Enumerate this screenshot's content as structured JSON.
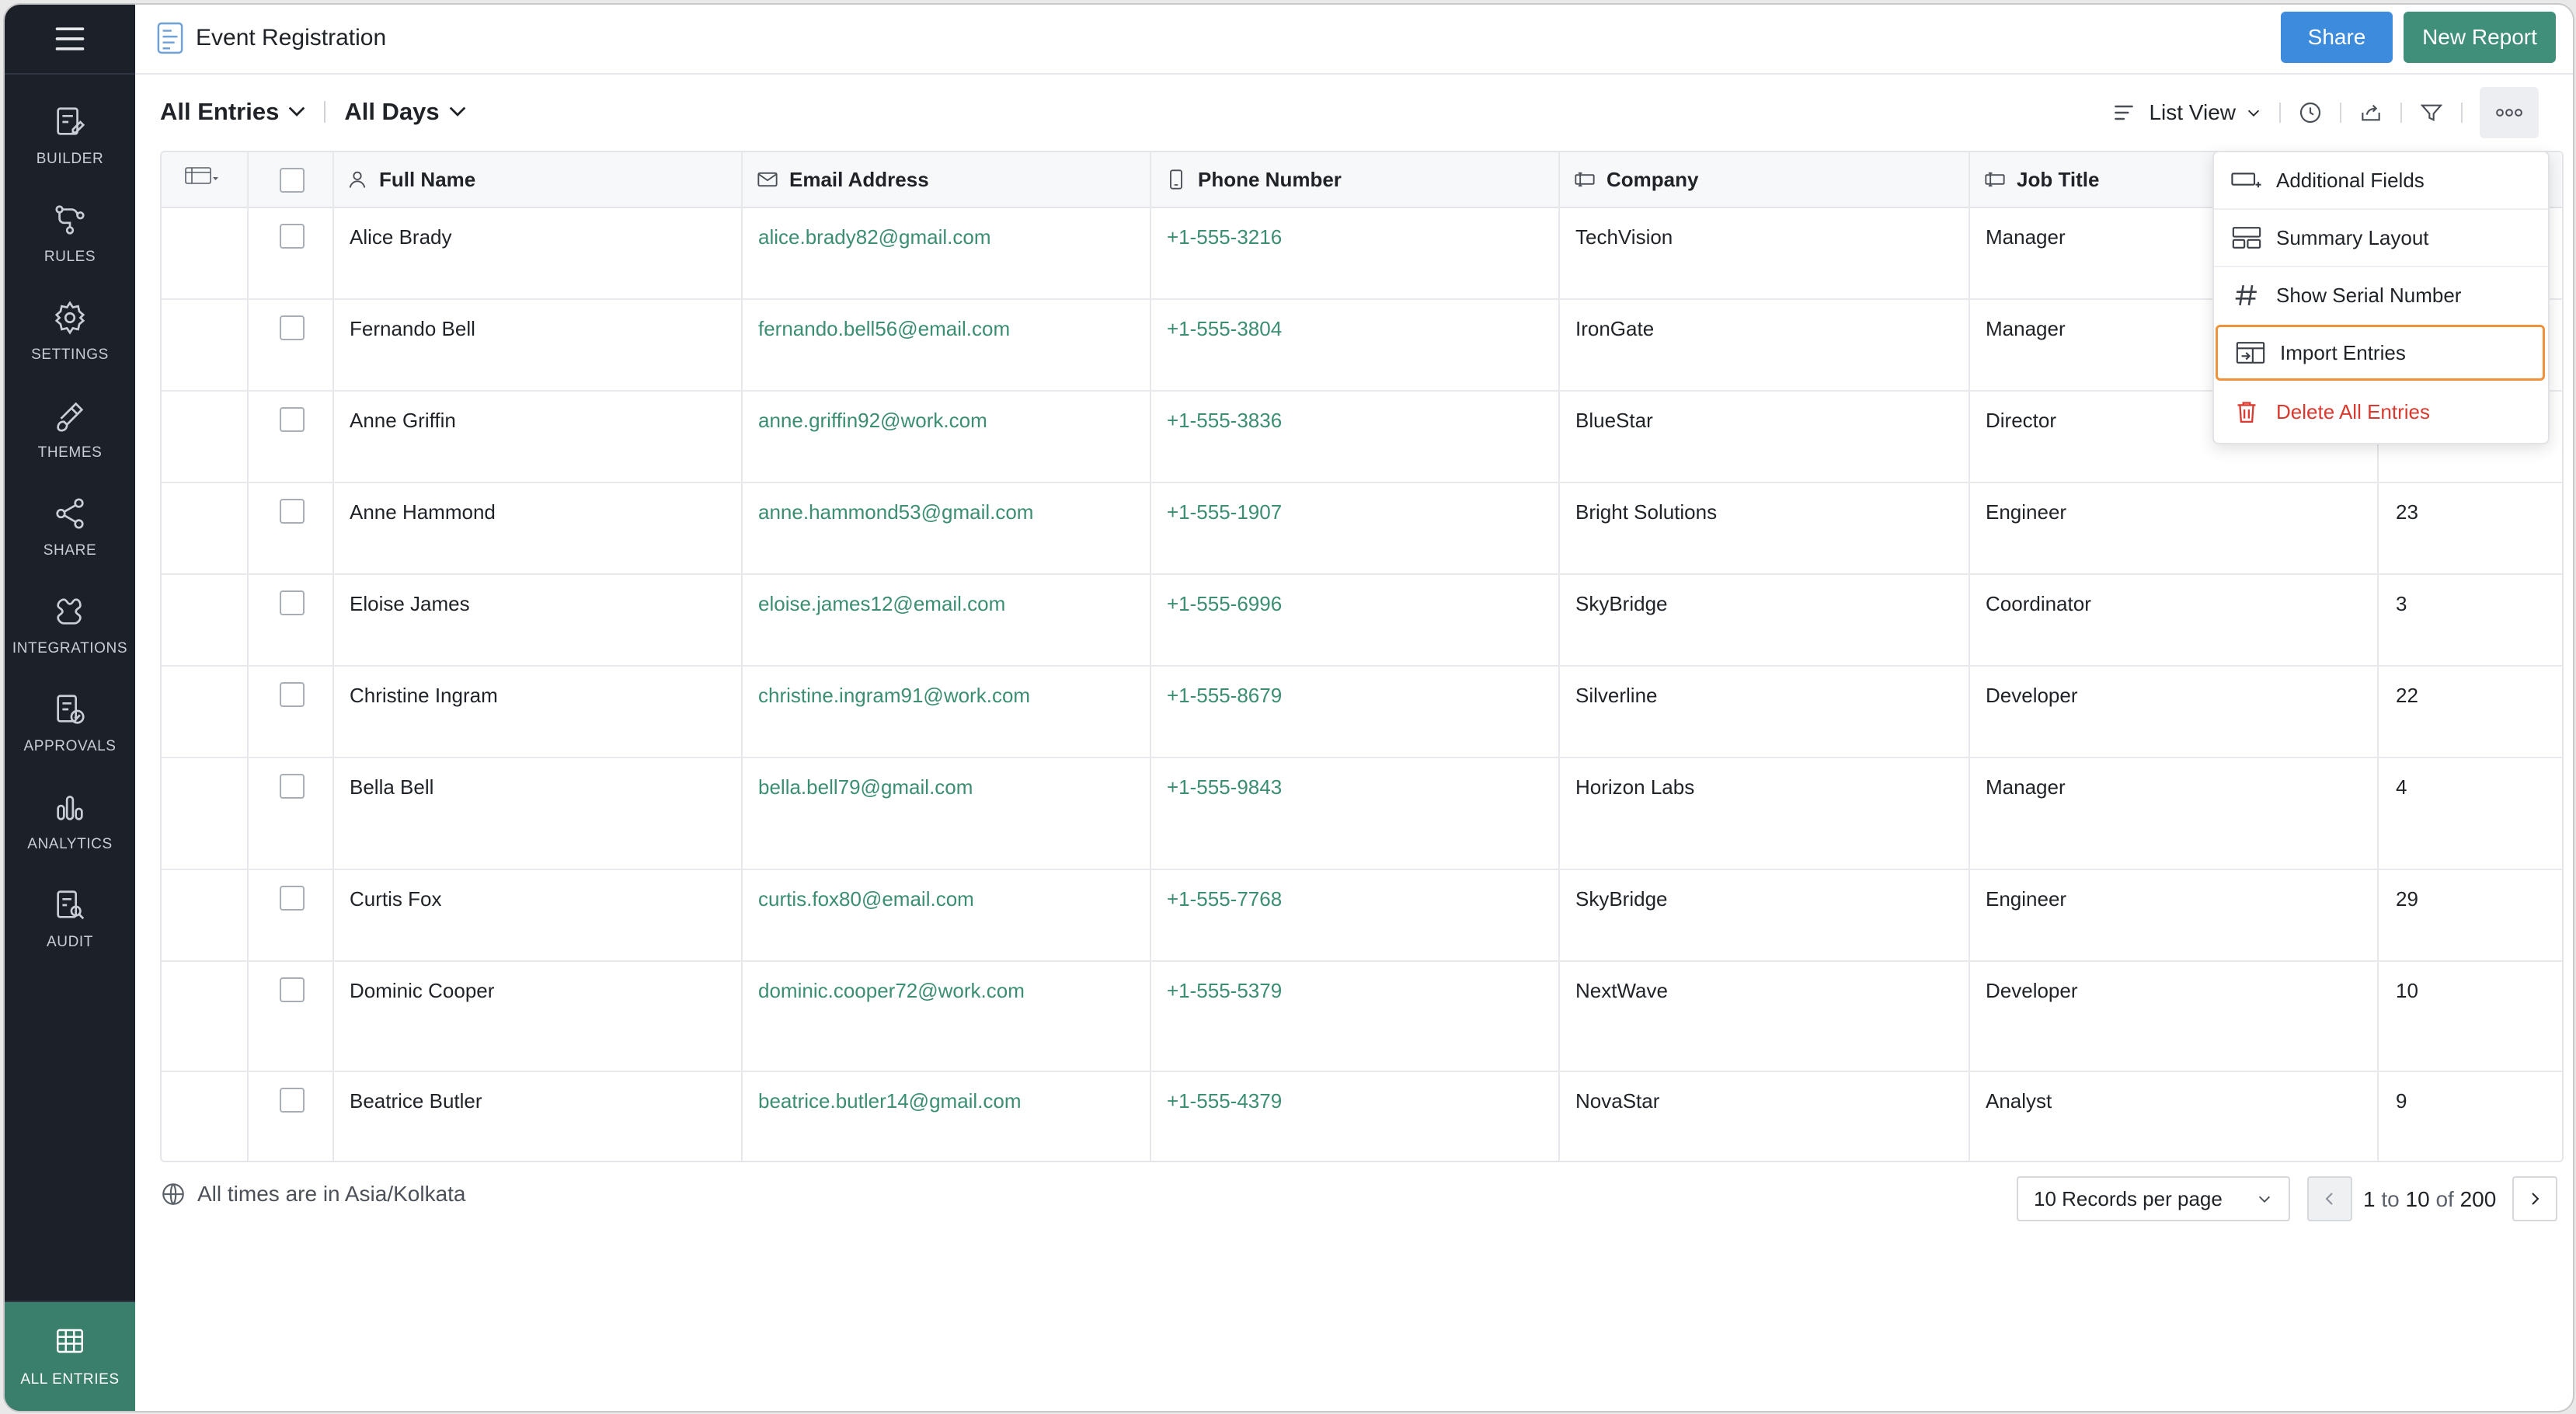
{
  "app": {
    "title": "Event Registration",
    "share_label": "Share",
    "new_report_label": "New Report"
  },
  "sidebar": {
    "items": [
      {
        "label": "BUILDER",
        "icon": "builder-icon"
      },
      {
        "label": "RULES",
        "icon": "rules-icon"
      },
      {
        "label": "SETTINGS",
        "icon": "gear-icon"
      },
      {
        "label": "THEMES",
        "icon": "brush-icon"
      },
      {
        "label": "SHARE",
        "icon": "share-icon"
      },
      {
        "label": "INTEGRATIONS",
        "icon": "plug-icon"
      },
      {
        "label": "APPROVALS",
        "icon": "approvals-icon"
      },
      {
        "label": "ANALYTICS",
        "icon": "analytics-icon"
      },
      {
        "label": "AUDIT",
        "icon": "audit-icon"
      }
    ],
    "active": {
      "label": "ALL ENTRIES",
      "icon": "table-icon"
    }
  },
  "filters": {
    "entries": "All Entries",
    "days": "All Days"
  },
  "view": {
    "label": "List View"
  },
  "table": {
    "headers": [
      "Full Name",
      "Email Address",
      "Phone Number",
      "Company",
      "Job Title"
    ],
    "rows": [
      {
        "name": "Alice Brady",
        "email": "alice.brady82@gmail.com",
        "phone": "+1-555-3216",
        "company": "TechVision",
        "job": "Manager",
        "extra": ""
      },
      {
        "name": "Fernando Bell",
        "email": "fernando.bell56@email.com",
        "phone": "+1-555-3804",
        "company": "IronGate",
        "job": "Manager",
        "extra": ""
      },
      {
        "name": "Anne Griffin",
        "email": "anne.griffin92@work.com",
        "phone": "+1-555-3836",
        "company": "BlueStar",
        "job": "Director",
        "extra": ""
      },
      {
        "name": "Anne Hammond",
        "email": "anne.hammond53@gmail.com",
        "phone": "+1-555-1907",
        "company": "Bright Solutions",
        "job": "Engineer",
        "extra": "23"
      },
      {
        "name": "Eloise James",
        "email": "eloise.james12@email.com",
        "phone": "+1-555-6996",
        "company": "SkyBridge",
        "job": "Coordinator",
        "extra": "3"
      },
      {
        "name": "Christine Ingram",
        "email": "christine.ingram91@work.com",
        "phone": "+1-555-8679",
        "company": "Silverline",
        "job": "Developer",
        "extra": "22"
      },
      {
        "name": "Bella Bell",
        "email": "bella.bell79@gmail.com",
        "phone": "+1-555-9843",
        "company": "Horizon Labs",
        "job": "Manager",
        "extra": "4"
      },
      {
        "name": "Curtis Fox",
        "email": "curtis.fox80@email.com",
        "phone": "+1-555-7768",
        "company": "SkyBridge",
        "job": "Engineer",
        "extra": "29"
      },
      {
        "name": "Dominic Cooper",
        "email": "dominic.cooper72@work.com",
        "phone": "+1-555-5379",
        "company": "NextWave",
        "job": "Developer",
        "extra": "10"
      },
      {
        "name": "Beatrice Butler",
        "email": "beatrice.butler14@gmail.com",
        "phone": "+1-555-4379",
        "company": "NovaStar",
        "job": "Analyst",
        "extra": "9"
      }
    ]
  },
  "menu": {
    "items": [
      {
        "label": "Additional Fields",
        "icon": "add-field-icon"
      },
      {
        "label": "Summary Layout",
        "icon": "layout-icon"
      },
      {
        "label": "Show Serial Number",
        "icon": "hash-icon"
      },
      {
        "label": "Import Entries",
        "icon": "import-icon"
      },
      {
        "label": "Delete All Entries",
        "icon": "trash-icon"
      }
    ],
    "highlighted": "Import Entries"
  },
  "footer": {
    "timezone": "All times are in Asia/Kolkata",
    "per_page": "10 Records per page",
    "range_start": "1",
    "range_to": "to",
    "range_end": "10",
    "range_of": "of",
    "total": "200"
  },
  "colors": {
    "sidebar_bg": "#1c2129",
    "active_nav": "#3a7f6b",
    "share_btn": "#3d8bdc",
    "new_report_btn": "#3f8f7a",
    "link_green": "#3b8e72",
    "danger": "#d9392e",
    "highlight": "#f0913b"
  }
}
